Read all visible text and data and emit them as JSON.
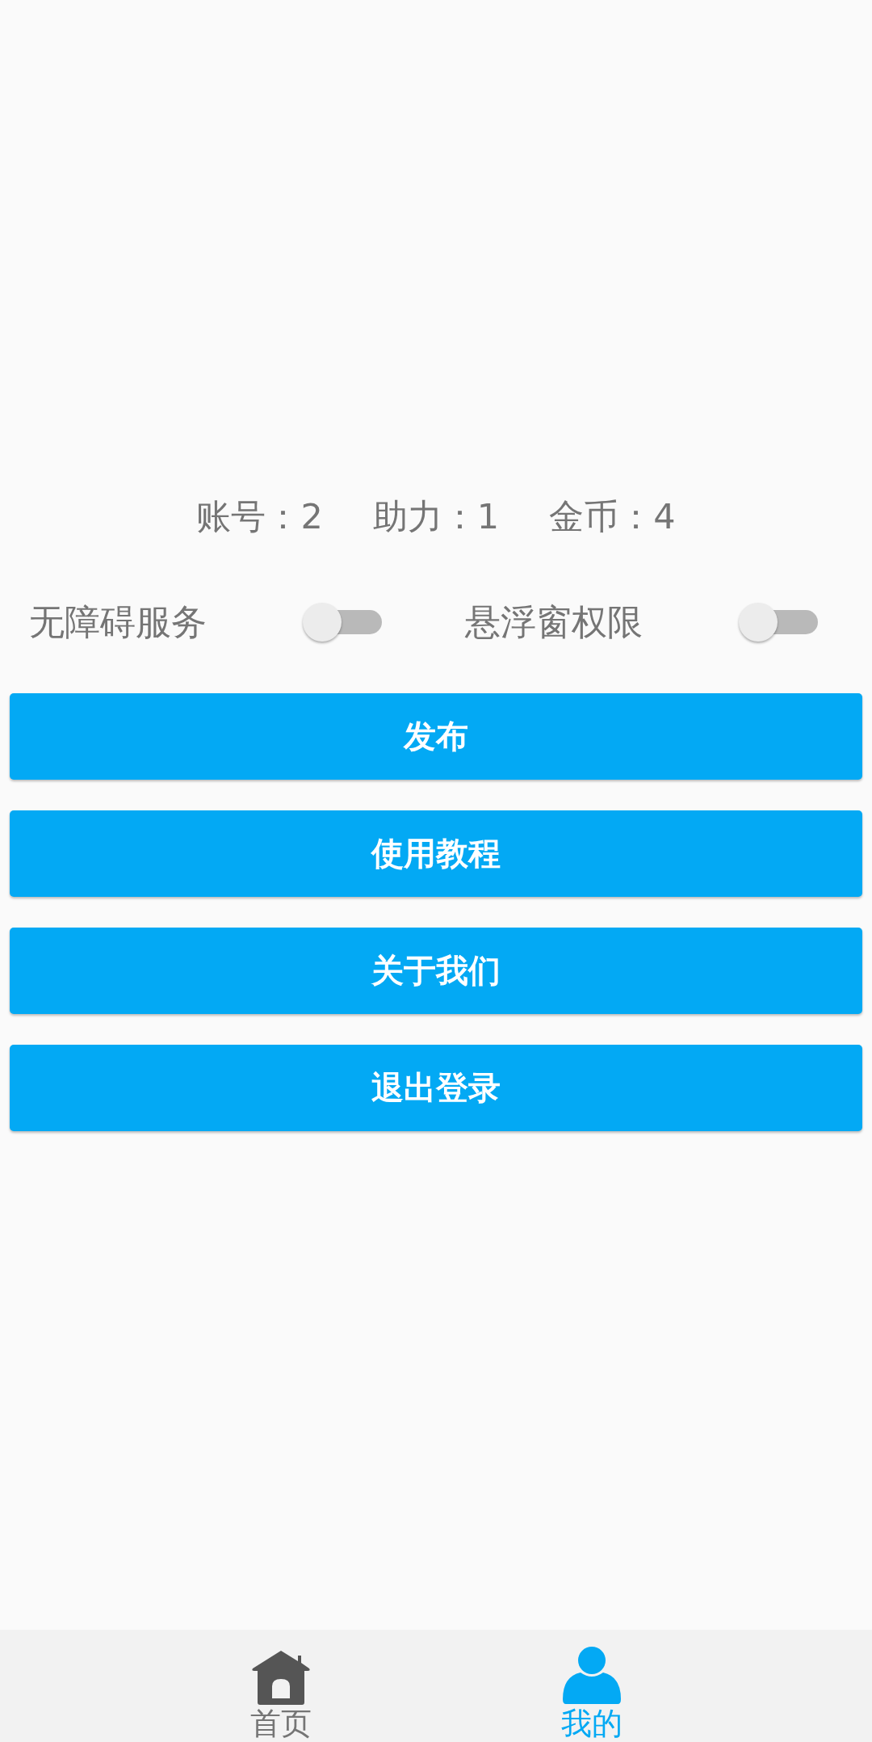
{
  "stats": [
    {
      "label": "账号：",
      "value": "2"
    },
    {
      "label": "助力：",
      "value": "1"
    },
    {
      "label": "金币：",
      "value": "4"
    }
  ],
  "switches": [
    {
      "label": "无障碍服务",
      "on": false
    },
    {
      "label": "悬浮窗权限",
      "on": false
    }
  ],
  "buttons": [
    "发布",
    "使用教程",
    "关于我们",
    "退出登录"
  ],
  "nav": [
    {
      "label": "首页",
      "kind": "home",
      "selected": false
    },
    {
      "label": "我的",
      "kind": "person",
      "selected": true
    }
  ]
}
